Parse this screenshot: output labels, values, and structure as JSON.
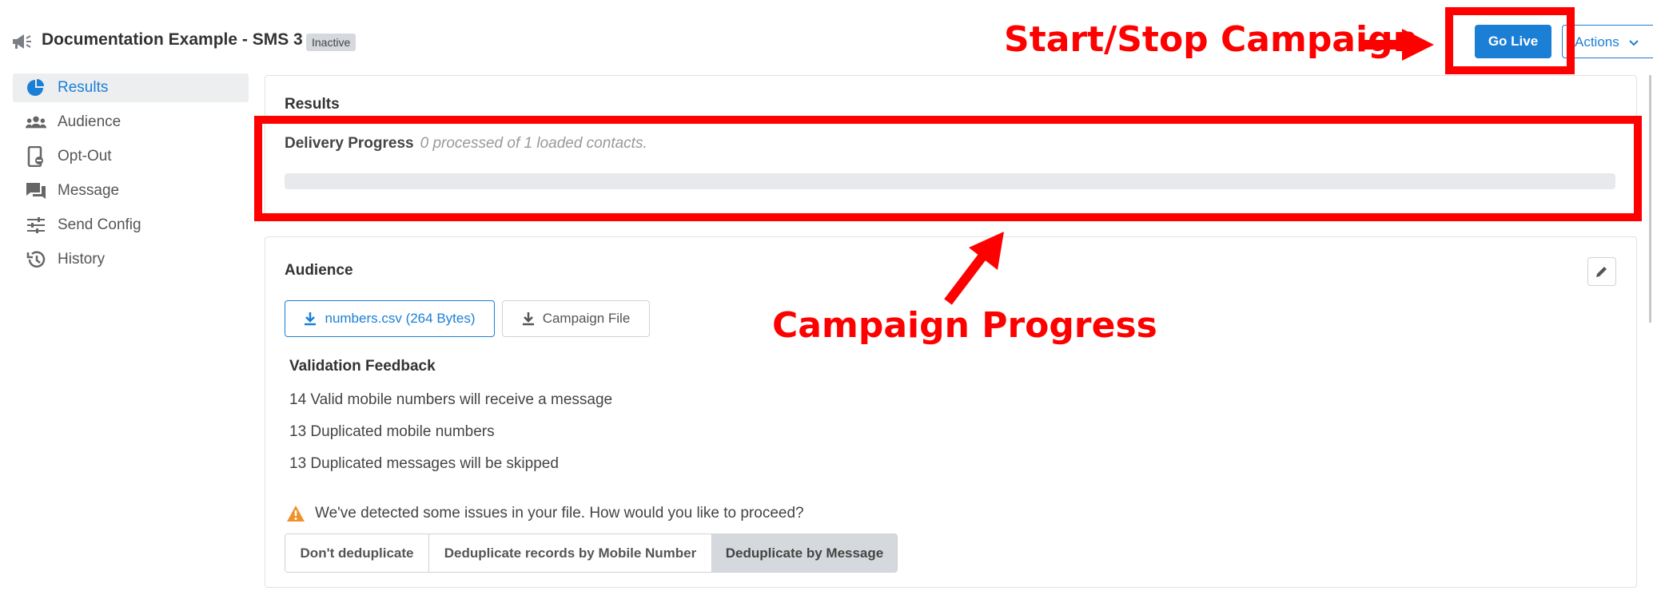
{
  "header": {
    "icon": "megaphone-icon",
    "title": "Documentation Example - SMS 3",
    "status": "Inactive",
    "go_live_label": "Go Live",
    "actions_label": "Actions"
  },
  "sidebar": {
    "items": [
      {
        "label": "Results",
        "icon": "pie-chart-icon",
        "active": true
      },
      {
        "label": "Audience",
        "icon": "users-icon",
        "active": false
      },
      {
        "label": "Opt-Out",
        "icon": "phone-optout-icon",
        "active": false
      },
      {
        "label": "Message",
        "icon": "chat-icon",
        "active": false
      },
      {
        "label": "Send Config",
        "icon": "sliders-icon",
        "active": false
      },
      {
        "label": "History",
        "icon": "history-icon",
        "active": false
      }
    ]
  },
  "results": {
    "heading": "Results",
    "progress_label": "Delivery Progress",
    "progress_note": "0 processed of 1 loaded contacts.",
    "progress_fraction": 0
  },
  "audience": {
    "heading": "Audience",
    "file_button": "numbers.csv (264 Bytes)",
    "campaign_file_button": "Campaign File",
    "feedback_heading": "Validation Feedback",
    "feedback_lines": [
      "14 Valid mobile numbers will receive a message",
      "13 Duplicated mobile numbers",
      "13 Duplicated messages will be skipped"
    ],
    "warning": "We've detected some issues in your file. How would you like to proceed?",
    "dedupe_options": [
      {
        "label": "Don't deduplicate",
        "selected": false
      },
      {
        "label": "Deduplicate records by Mobile Number",
        "selected": false
      },
      {
        "label": "Deduplicate by Message",
        "selected": true
      }
    ]
  },
  "annotations": {
    "start_stop": "Start/Stop Campaign",
    "campaign_progress": "Campaign Progress",
    "color": "#ff0000"
  },
  "colors": {
    "accent": "#1b7fd6",
    "badge_bg": "#d5d8dc",
    "warning": "#f0922b"
  }
}
